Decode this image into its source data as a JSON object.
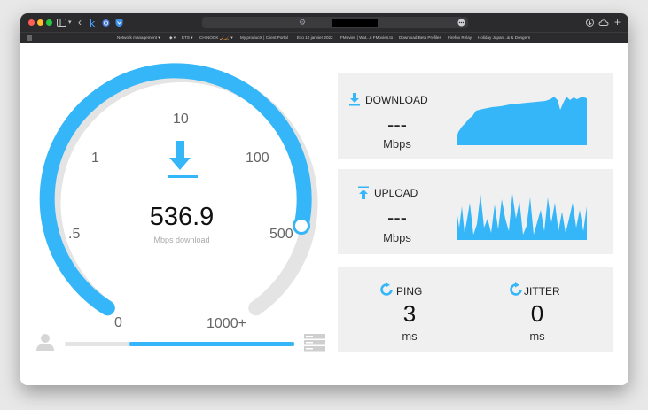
{
  "colors": {
    "accent": "#35b6f8",
    "track": "#e4e4e4",
    "panel_bg": "#f0f0f0"
  },
  "browser": {
    "bookmarks": [
      "Network management ▾",
      "◆ ▾",
      "ETS ▾",
      "CHINOOK 🏒🏒 ▾",
      "My products | Client Portal",
      "Exo 10 janvier 2022",
      "FMovies | Wat...n FMovies.to",
      "Download Beta Profiles",
      "Firefox Relay",
      "Holiday Japan...& & Dongers"
    ]
  },
  "gauge": {
    "ticks": [
      "0",
      ".5",
      "1",
      "10",
      "100",
      "500",
      "1000+"
    ],
    "value": "536.9",
    "unit": "Mbps download",
    "download_icon": "download-arrow-icon"
  },
  "download": {
    "title": "DOWNLOAD",
    "value": "---",
    "unit": "Mbps",
    "icon": "download-arrow-icon"
  },
  "upload": {
    "title": "UPLOAD",
    "value": "---",
    "unit": "Mbps",
    "icon": "upload-arrow-icon"
  },
  "ping": {
    "title": "PING",
    "value": "3",
    "unit": "ms",
    "icon": "refresh-icon"
  },
  "jitter": {
    "title": "JITTER",
    "value": "0",
    "unit": "ms",
    "icon": "refresh-icon"
  },
  "progress": {
    "fraction": 0.72
  }
}
